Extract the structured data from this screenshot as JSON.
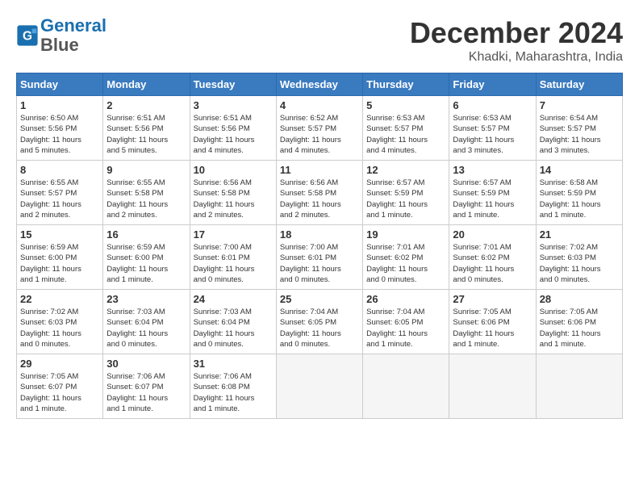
{
  "header": {
    "logo_line1": "General",
    "logo_line2": "Blue",
    "month": "December 2024",
    "location": "Khadki, Maharashtra, India"
  },
  "weekdays": [
    "Sunday",
    "Monday",
    "Tuesday",
    "Wednesday",
    "Thursday",
    "Friday",
    "Saturday"
  ],
  "weeks": [
    [
      {
        "day": 1,
        "info": "Sunrise: 6:50 AM\nSunset: 5:56 PM\nDaylight: 11 hours\nand 5 minutes."
      },
      {
        "day": 2,
        "info": "Sunrise: 6:51 AM\nSunset: 5:56 PM\nDaylight: 11 hours\nand 5 minutes."
      },
      {
        "day": 3,
        "info": "Sunrise: 6:51 AM\nSunset: 5:56 PM\nDaylight: 11 hours\nand 4 minutes."
      },
      {
        "day": 4,
        "info": "Sunrise: 6:52 AM\nSunset: 5:57 PM\nDaylight: 11 hours\nand 4 minutes."
      },
      {
        "day": 5,
        "info": "Sunrise: 6:53 AM\nSunset: 5:57 PM\nDaylight: 11 hours\nand 4 minutes."
      },
      {
        "day": 6,
        "info": "Sunrise: 6:53 AM\nSunset: 5:57 PM\nDaylight: 11 hours\nand 3 minutes."
      },
      {
        "day": 7,
        "info": "Sunrise: 6:54 AM\nSunset: 5:57 PM\nDaylight: 11 hours\nand 3 minutes."
      }
    ],
    [
      {
        "day": 8,
        "info": "Sunrise: 6:55 AM\nSunset: 5:57 PM\nDaylight: 11 hours\nand 2 minutes."
      },
      {
        "day": 9,
        "info": "Sunrise: 6:55 AM\nSunset: 5:58 PM\nDaylight: 11 hours\nand 2 minutes."
      },
      {
        "day": 10,
        "info": "Sunrise: 6:56 AM\nSunset: 5:58 PM\nDaylight: 11 hours\nand 2 minutes."
      },
      {
        "day": 11,
        "info": "Sunrise: 6:56 AM\nSunset: 5:58 PM\nDaylight: 11 hours\nand 2 minutes."
      },
      {
        "day": 12,
        "info": "Sunrise: 6:57 AM\nSunset: 5:59 PM\nDaylight: 11 hours\nand 1 minute."
      },
      {
        "day": 13,
        "info": "Sunrise: 6:57 AM\nSunset: 5:59 PM\nDaylight: 11 hours\nand 1 minute."
      },
      {
        "day": 14,
        "info": "Sunrise: 6:58 AM\nSunset: 5:59 PM\nDaylight: 11 hours\nand 1 minute."
      }
    ],
    [
      {
        "day": 15,
        "info": "Sunrise: 6:59 AM\nSunset: 6:00 PM\nDaylight: 11 hours\nand 1 minute."
      },
      {
        "day": 16,
        "info": "Sunrise: 6:59 AM\nSunset: 6:00 PM\nDaylight: 11 hours\nand 1 minute."
      },
      {
        "day": 17,
        "info": "Sunrise: 7:00 AM\nSunset: 6:01 PM\nDaylight: 11 hours\nand 0 minutes."
      },
      {
        "day": 18,
        "info": "Sunrise: 7:00 AM\nSunset: 6:01 PM\nDaylight: 11 hours\nand 0 minutes."
      },
      {
        "day": 19,
        "info": "Sunrise: 7:01 AM\nSunset: 6:02 PM\nDaylight: 11 hours\nand 0 minutes."
      },
      {
        "day": 20,
        "info": "Sunrise: 7:01 AM\nSunset: 6:02 PM\nDaylight: 11 hours\nand 0 minutes."
      },
      {
        "day": 21,
        "info": "Sunrise: 7:02 AM\nSunset: 6:03 PM\nDaylight: 11 hours\nand 0 minutes."
      }
    ],
    [
      {
        "day": 22,
        "info": "Sunrise: 7:02 AM\nSunset: 6:03 PM\nDaylight: 11 hours\nand 0 minutes."
      },
      {
        "day": 23,
        "info": "Sunrise: 7:03 AM\nSunset: 6:04 PM\nDaylight: 11 hours\nand 0 minutes."
      },
      {
        "day": 24,
        "info": "Sunrise: 7:03 AM\nSunset: 6:04 PM\nDaylight: 11 hours\nand 0 minutes."
      },
      {
        "day": 25,
        "info": "Sunrise: 7:04 AM\nSunset: 6:05 PM\nDaylight: 11 hours\nand 0 minutes."
      },
      {
        "day": 26,
        "info": "Sunrise: 7:04 AM\nSunset: 6:05 PM\nDaylight: 11 hours\nand 1 minute."
      },
      {
        "day": 27,
        "info": "Sunrise: 7:05 AM\nSunset: 6:06 PM\nDaylight: 11 hours\nand 1 minute."
      },
      {
        "day": 28,
        "info": "Sunrise: 7:05 AM\nSunset: 6:06 PM\nDaylight: 11 hours\nand 1 minute."
      }
    ],
    [
      {
        "day": 29,
        "info": "Sunrise: 7:05 AM\nSunset: 6:07 PM\nDaylight: 11 hours\nand 1 minute."
      },
      {
        "day": 30,
        "info": "Sunrise: 7:06 AM\nSunset: 6:07 PM\nDaylight: 11 hours\nand 1 minute."
      },
      {
        "day": 31,
        "info": "Sunrise: 7:06 AM\nSunset: 6:08 PM\nDaylight: 11 hours\nand 1 minute."
      },
      null,
      null,
      null,
      null
    ]
  ]
}
